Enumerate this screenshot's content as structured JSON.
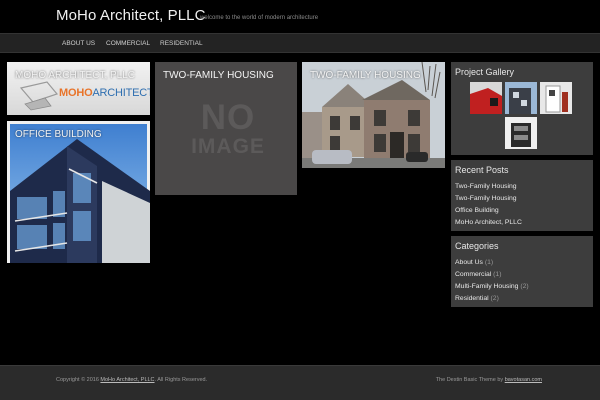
{
  "site": {
    "title": "MoHo Architect, PLLC",
    "tagline": "welcome to the world of modern architecture"
  },
  "nav": {
    "items": [
      {
        "label": "ABOUT US"
      },
      {
        "label": "COMMERCIAL"
      },
      {
        "label": "RESIDENTIAL"
      }
    ]
  },
  "posts": [
    {
      "title": "MOHO ARCHITECT, PLLC",
      "logo_text_1": "MOHO",
      "logo_text_2": "ARCHITECT"
    },
    {
      "title": "OFFICE BUILDING"
    },
    {
      "title": "TWO-FAMILY HOUSING",
      "placeholder_line1": "NO",
      "placeholder_line2": "IMAGE"
    },
    {
      "title": "TWO-FAMILY HOUSING"
    }
  ],
  "sidebar": {
    "gallery": {
      "title": "Project Gallery"
    },
    "recent_posts": {
      "title": "Recent Posts",
      "items": [
        "Two-Family Housing",
        "Two-Family Housing",
        "Office Building",
        "MoHo Architect, PLLC"
      ]
    },
    "categories": {
      "title": "Categories",
      "items": [
        {
          "label": "About Us",
          "count": "(1)"
        },
        {
          "label": "Commercial",
          "count": "(1)"
        },
        {
          "label": "Multi-Family Housing",
          "count": "(2)"
        },
        {
          "label": "Residential",
          "count": "(2)"
        }
      ]
    }
  },
  "footer": {
    "copyright_prefix": "Copyright © 2016",
    "copyright_link": "MoHo Architect, PLLC",
    "copyright_suffix": "All Rights Reserved.",
    "theme_prefix": "The Destin Basic Theme by",
    "theme_link": "bavotasan.com"
  },
  "colors": {
    "background": "#000000",
    "navbar": "#232323",
    "widget": "#3d3d3d",
    "footer": "#2b2b2b",
    "logo_orange": "#e8742a",
    "logo_blue": "#2f6fb0"
  }
}
